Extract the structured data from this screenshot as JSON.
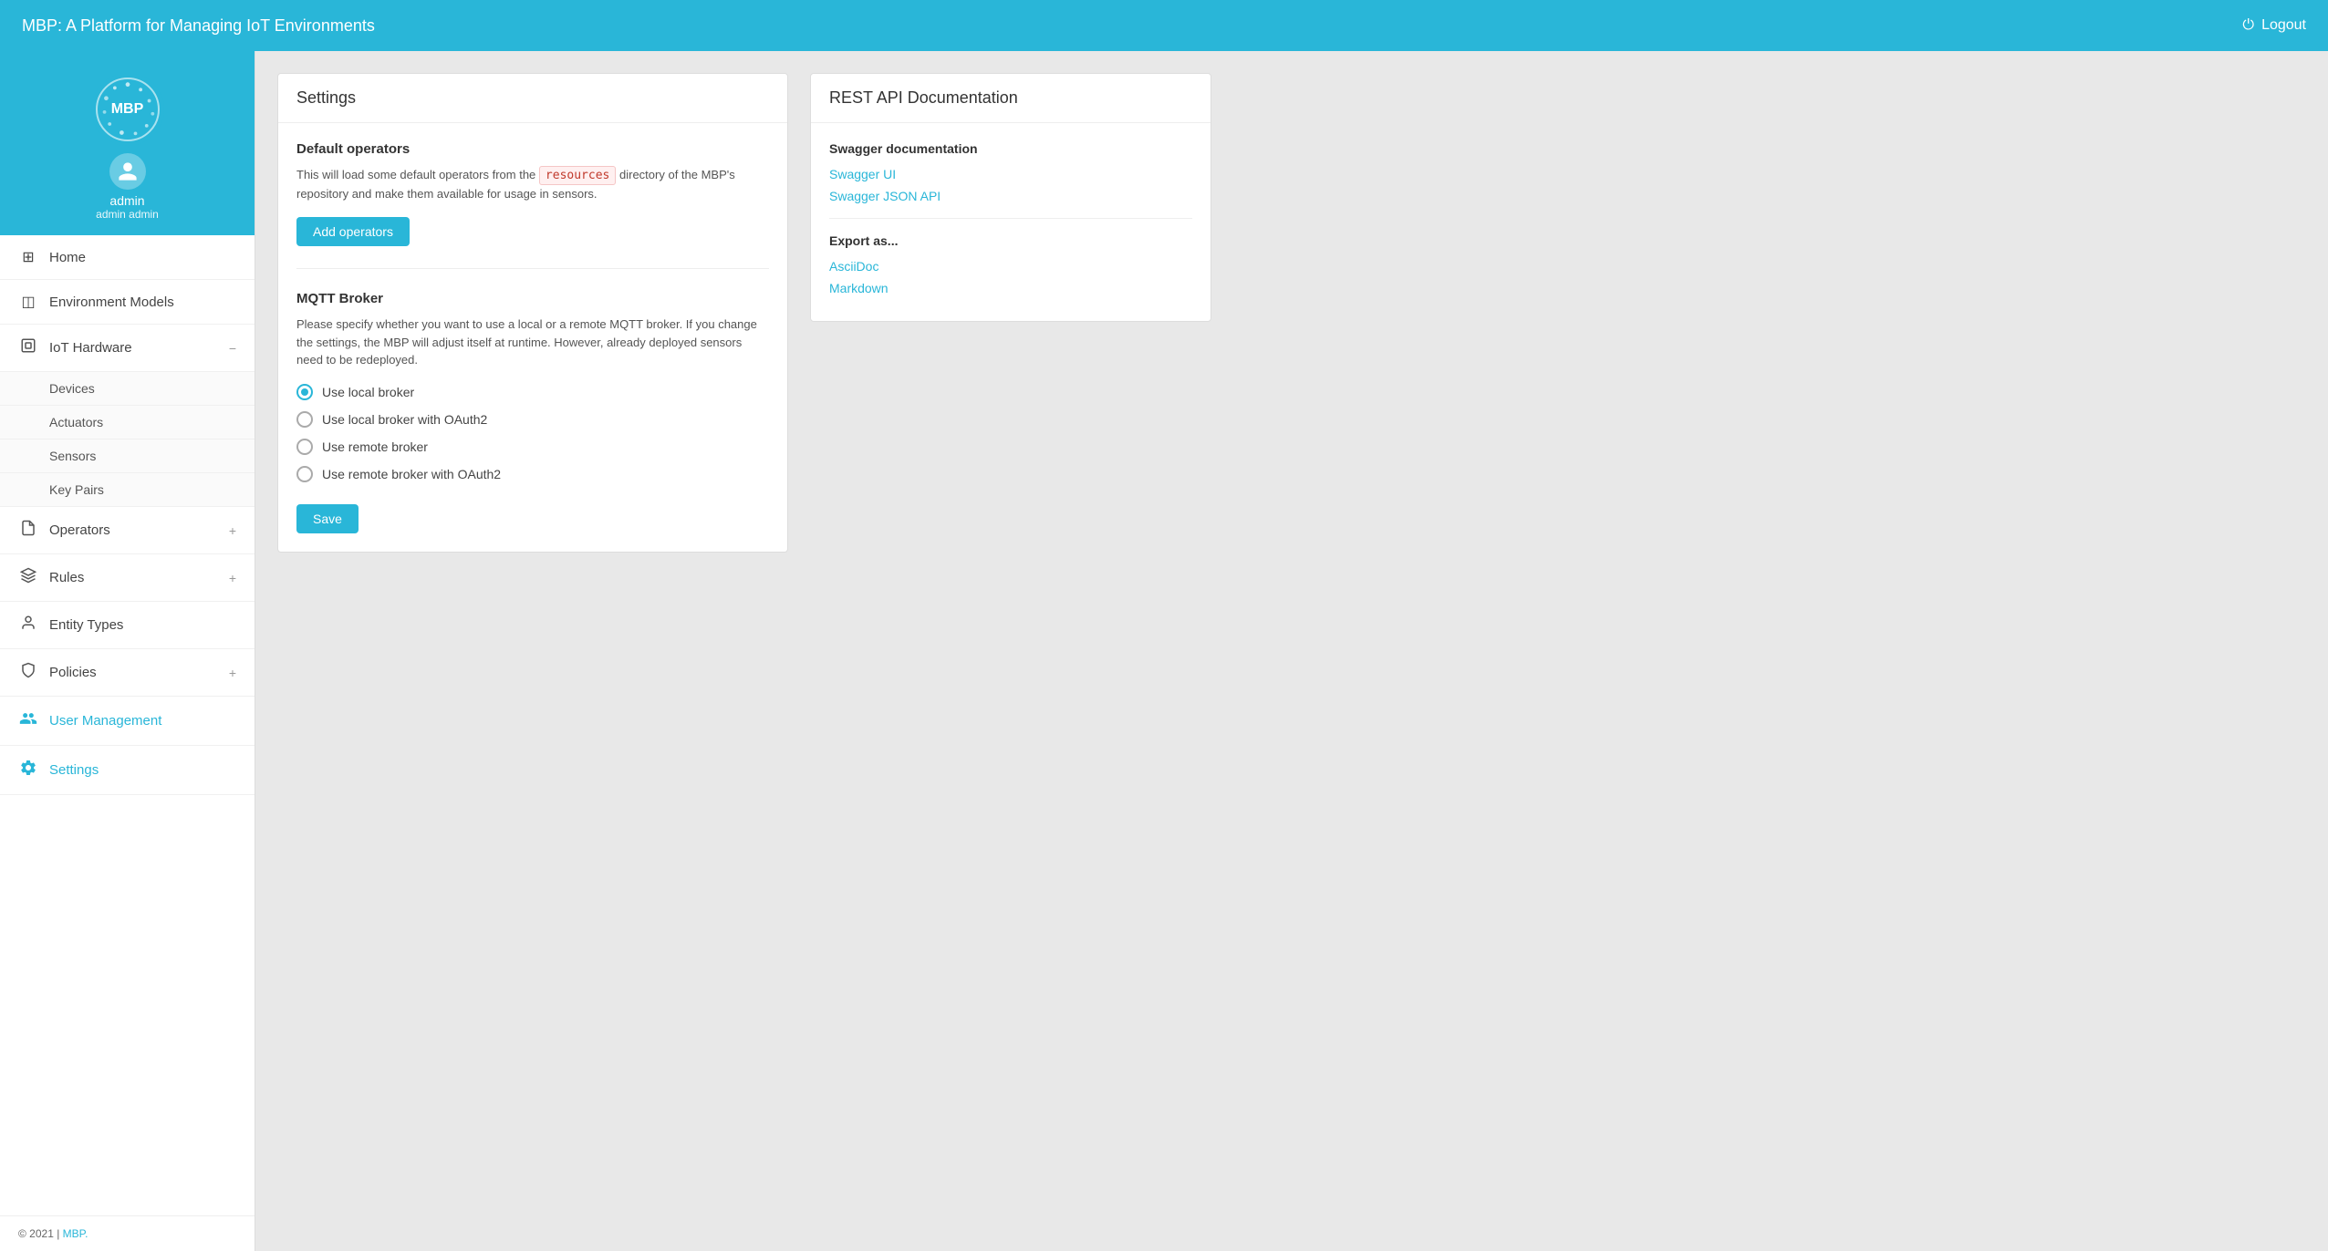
{
  "topbar": {
    "title": "MBP: A Platform for Managing IoT Environments",
    "logout_label": "Logout"
  },
  "sidebar": {
    "logo_text": "MBP",
    "user": {
      "name": "admin",
      "full_name": "admin admin"
    },
    "nav_items": [
      {
        "id": "home",
        "label": "Home",
        "icon": "⊞",
        "expandable": false
      },
      {
        "id": "environment-models",
        "label": "Environment Models",
        "icon": "◫",
        "expandable": false
      },
      {
        "id": "iot-hardware",
        "label": "IoT Hardware",
        "icon": "⊡",
        "expandable": true,
        "expanded": true
      },
      {
        "id": "operators",
        "label": "Operators",
        "icon": "📄",
        "expandable": true,
        "expanded": false
      },
      {
        "id": "rules",
        "label": "Rules",
        "icon": "⚙",
        "expandable": true,
        "expanded": false
      },
      {
        "id": "entity-types",
        "label": "Entity Types",
        "icon": "👤",
        "expandable": false
      },
      {
        "id": "policies",
        "label": "Policies",
        "icon": "🛡",
        "expandable": true,
        "expanded": false
      },
      {
        "id": "user-management",
        "label": "User Management",
        "icon": "👥",
        "expandable": false,
        "active": false
      },
      {
        "id": "settings",
        "label": "Settings",
        "icon": "⚙",
        "expandable": false,
        "active": true
      }
    ],
    "iot_sub_items": [
      {
        "id": "devices",
        "label": "Devices"
      },
      {
        "id": "actuators",
        "label": "Actuators"
      },
      {
        "id": "sensors",
        "label": "Sensors"
      },
      {
        "id": "key-pairs",
        "label": "Key Pairs"
      }
    ],
    "footer": {
      "copyright": "© 2021 |",
      "link_label": "MBP."
    }
  },
  "settings_card": {
    "title": "Settings",
    "default_operators": {
      "section_title": "Default operators",
      "description_before": "This will load some default operators from the",
      "code_text": "resources",
      "description_after": "directory of the MBP's repository and make them available for usage in sensors.",
      "button_label": "Add operators"
    },
    "mqtt_broker": {
      "section_title": "MQTT Broker",
      "description": "Please specify whether you want to use a local or a remote MQTT broker. If you change the settings, the MBP will adjust itself at runtime. However, already deployed sensors need to be redeployed.",
      "options": [
        {
          "id": "local",
          "label": "Use local broker",
          "selected": true
        },
        {
          "id": "local-oauth2",
          "label": "Use local broker with OAuth2",
          "selected": false
        },
        {
          "id": "remote",
          "label": "Use remote broker",
          "selected": false
        },
        {
          "id": "remote-oauth2",
          "label": "Use remote broker with OAuth2",
          "selected": false
        }
      ],
      "save_label": "Save"
    }
  },
  "api_card": {
    "title": "REST API Documentation",
    "swagger": {
      "section_title": "Swagger documentation",
      "links": [
        {
          "id": "swagger-ui",
          "label": "Swagger UI"
        },
        {
          "id": "swagger-json",
          "label": "Swagger JSON API"
        }
      ]
    },
    "export": {
      "section_title": "Export as...",
      "links": [
        {
          "id": "asciidoc",
          "label": "AsciiDoc"
        },
        {
          "id": "markdown",
          "label": "Markdown"
        }
      ]
    }
  }
}
